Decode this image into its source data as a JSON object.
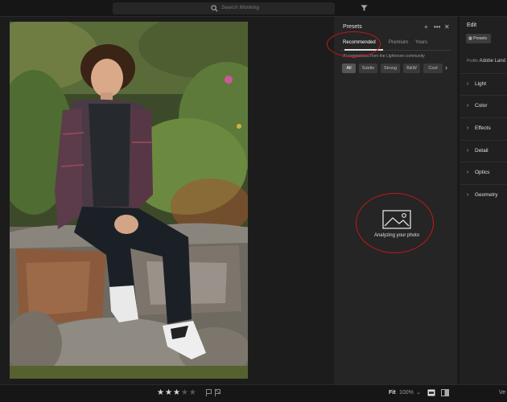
{
  "search": {
    "placeholder": "Search Monking",
    "icon": "search-icon"
  },
  "presets_panel": {
    "title": "Presets",
    "tabs": [
      {
        "label": "Recommended",
        "active": true
      },
      {
        "label": "Premium",
        "active": false
      },
      {
        "label": "Yours",
        "active": false
      }
    ],
    "ai_text": "AI suggestions from the Lightroom community",
    "chips": [
      {
        "label": "All",
        "selected": true
      },
      {
        "label": "Subtle",
        "selected": false
      },
      {
        "label": "Strong",
        "selected": false
      },
      {
        "label": "B&W",
        "selected": false
      },
      {
        "label": "Cool",
        "selected": false
      }
    ],
    "status_text": "Analyzing your photo"
  },
  "edit_panel": {
    "title": "Edit",
    "presets_button": "Presets",
    "profile_label": "Profile",
    "profile_value": "Adobe Land",
    "sections": [
      "Light",
      "Color",
      "Effects",
      "Detail",
      "Optics",
      "Geometry"
    ]
  },
  "bottom_bar": {
    "rating": 3,
    "rating_max": 5,
    "fit_label": "Fit",
    "zoom": "100%",
    "version_label": "Ve"
  },
  "colors": {
    "annotation_red": "#c0181c",
    "panel_bg": "#252525",
    "app_bg": "#1c1c1c"
  }
}
